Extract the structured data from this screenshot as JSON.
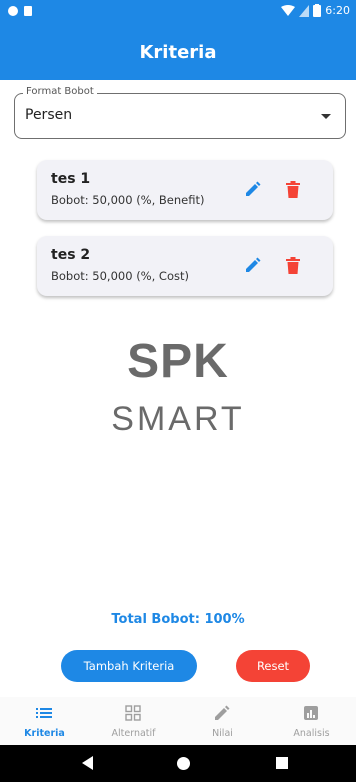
{
  "status_bar": {
    "time": "6:20"
  },
  "app_bar": {
    "title": "Kriteria"
  },
  "format": {
    "label": "Format Bobot",
    "value": "Persen"
  },
  "criteria": [
    {
      "name": "tes 1",
      "detail": "Bobot: 50,000 (%, Benefit)"
    },
    {
      "name": "tes 2",
      "detail": "Bobot: 50,000 (%, Cost)"
    }
  ],
  "logo": {
    "line1": "SPK",
    "line2": "SMART"
  },
  "total": "Total Bobot: 100%",
  "buttons": {
    "add": "Tambah Kriteria",
    "reset": "Reset"
  },
  "bottom_nav": [
    {
      "label": "Kriteria",
      "icon": "list-icon",
      "active": true
    },
    {
      "label": "Alternatif",
      "icon": "grid-icon",
      "active": false
    },
    {
      "label": "Nilai",
      "icon": "pencil-icon",
      "active": false
    },
    {
      "label": "Analisis",
      "icon": "chart-icon",
      "active": false
    }
  ],
  "colors": {
    "primary": "#1e88e5",
    "danger": "#f44336",
    "logo": "#6a6a6a"
  }
}
